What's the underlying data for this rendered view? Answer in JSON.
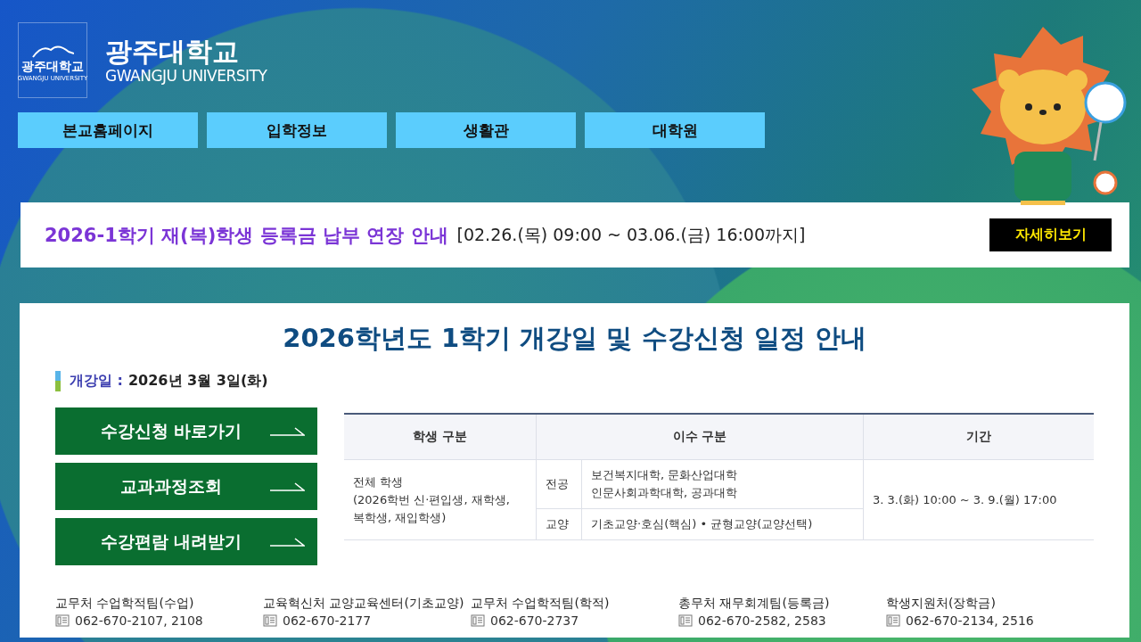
{
  "logo": {
    "emblem_name": "광주대학교",
    "emblem_english": "GWANGJU UNIVERSITY",
    "name": "광주대학교",
    "english": "GWANGJU UNIVERSITY"
  },
  "nav": [
    {
      "label": "본교홈페이지"
    },
    {
      "label": "입학정보"
    },
    {
      "label": "생활관"
    },
    {
      "label": "대학원"
    }
  ],
  "notice": {
    "title": "2026-1학기 재(복)학생 등록금 납부 연장 안내",
    "period": "[02.26.(목) 09:00 ~ 03.06.(금) 16:00까지]",
    "button": "자세히보기"
  },
  "main": {
    "title": "2026학년도 1학기 개강일 및 수강신청 일정 안내",
    "start_label": "개강일 :",
    "start_value": "2026년 3월 3일(화)",
    "buttons": [
      {
        "label": "수강신청 바로가기"
      },
      {
        "label": "교과과정조회"
      },
      {
        "label": "수강편람 내려받기"
      }
    ],
    "table": {
      "columns": [
        "학생 구분",
        "이수 구분",
        "기간"
      ],
      "student": [
        "전체 학생",
        "(2026학번 신·편입생, 재학생,",
        "복학생, 재입학생)"
      ],
      "courses": [
        {
          "type": "전공",
          "detail": [
            "보건복지대학, 문화산업대학",
            "인문사회과학대학, 공과대학"
          ]
        },
        {
          "type": "교양",
          "detail": [
            "기초교양·호심(핵심) • 균형교양(교양선택)"
          ]
        }
      ],
      "period": "3. 3.(화) 10:00 ~ 3. 9.(월) 17:00"
    },
    "contacts": [
      {
        "team": "교무처 수업학적팀(수업)",
        "phone": "062-670-2107, 2108"
      },
      {
        "team": "교육혁신처 교양교육센터(기초교양)",
        "phone": "062-670-2177"
      },
      {
        "team": "교무처 수업학적팀(학적)",
        "phone": "062-670-2737"
      },
      {
        "team": "총무처 재무회계팀(등록금)",
        "phone": "062-670-2582, 2583"
      },
      {
        "team": "학생지원처(장학금)",
        "phone": "062-670-2134, 2516"
      }
    ]
  }
}
